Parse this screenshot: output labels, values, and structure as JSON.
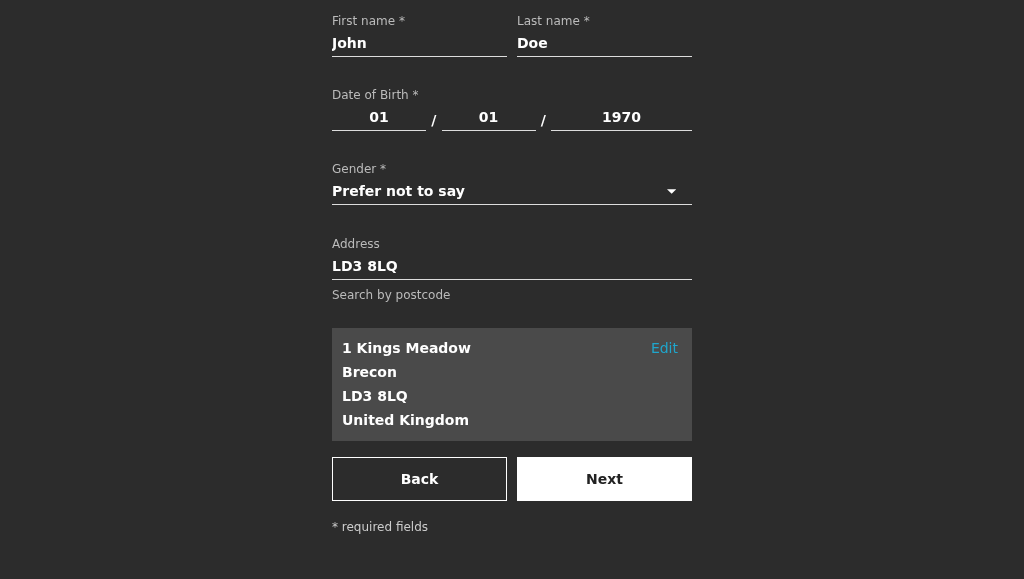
{
  "name_fields": [
    {
      "label": "First name *",
      "value": "John"
    },
    {
      "label": "Last name *",
      "value": "Doe"
    }
  ],
  "date_of_birth": {
    "label": "Date of Birth *",
    "parts": [
      {
        "value": "01",
        "separator": "/"
      },
      {
        "value": "01",
        "separator": "/"
      },
      {
        "value": "1970"
      }
    ]
  },
  "gender": {
    "label": "Gender *",
    "value": "Prefer not to say"
  },
  "address": {
    "label": "Address",
    "value": "LD3 8LQ",
    "helper": "Search by postcode"
  },
  "address_card": {
    "lines": [
      "1 Kings Meadow",
      "Brecon",
      "LD3 8LQ",
      "United Kingdom"
    ],
    "edit": "Edit"
  },
  "buttons": [
    {
      "label": "Back",
      "kind": "outline"
    },
    {
      "label": "Next",
      "kind": "filled"
    }
  ],
  "footnote": "* required fields"
}
